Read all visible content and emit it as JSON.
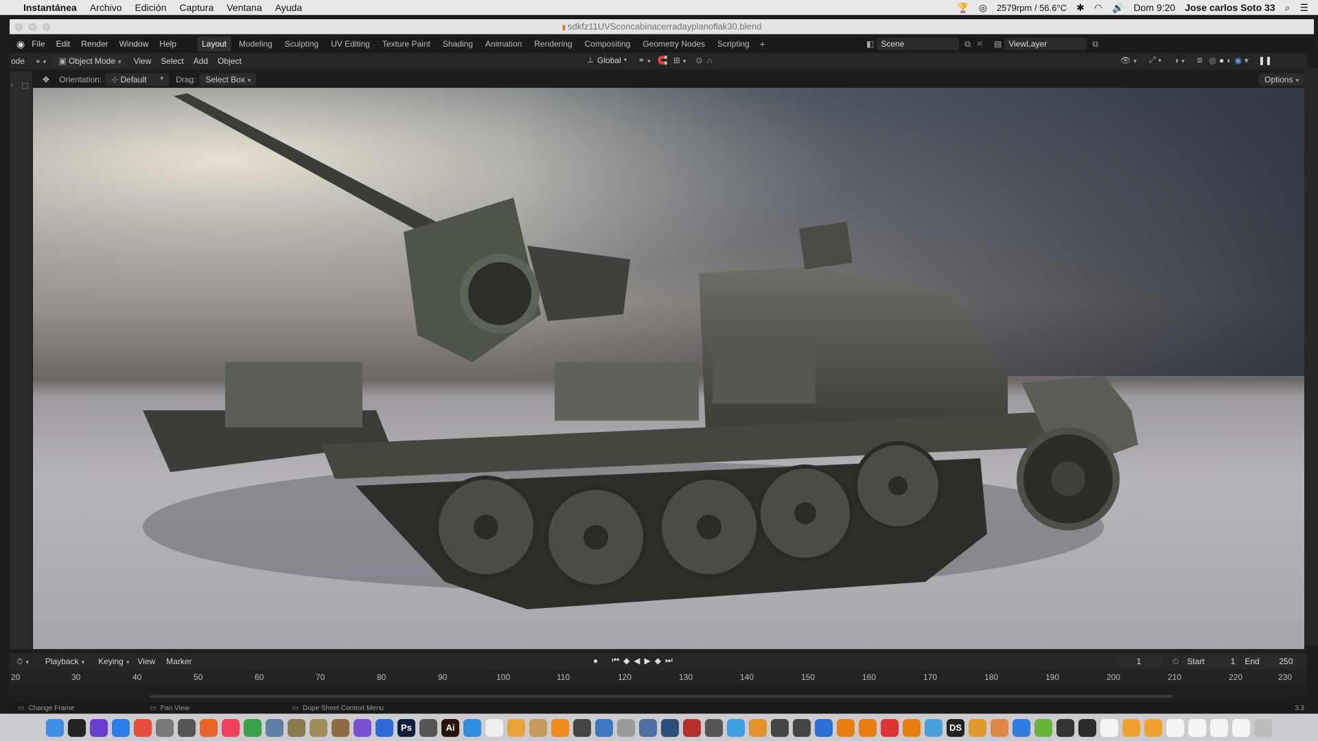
{
  "mac": {
    "app": "Instantánea",
    "menus": [
      "Archivo",
      "Edición",
      "Captura",
      "Ventana",
      "Ayuda"
    ],
    "status": {
      "temp": "2579rpm / 56.6°C",
      "clock": "Dom 9:20",
      "user": "Jose carlos Soto 33"
    }
  },
  "window": {
    "title": "sdkfz11UVSconcabinacerradayplanoflak30.blend"
  },
  "topbar": {
    "menus": [
      "File",
      "Edit",
      "Render",
      "Window",
      "Help"
    ],
    "workspaces": [
      "Layout",
      "Modeling",
      "Sculpting",
      "UV Editing",
      "Texture Paint",
      "Shading",
      "Animation",
      "Rendering",
      "Compositing",
      "Geometry Nodes",
      "Scripting"
    ],
    "active_workspace": "Layout",
    "scene": "Scene",
    "view_layer": "ViewLayer"
  },
  "viewport_header": {
    "editor_left": "ode",
    "mode": "Object Mode",
    "menus": [
      "View",
      "Select",
      "Add",
      "Object"
    ],
    "transform": "Global"
  },
  "tool_header": {
    "orientation_label": "Orientation:",
    "orientation_value": "Default",
    "drag_label": "Drag:",
    "drag_value": "Select Box",
    "options": "Options"
  },
  "timeline": {
    "menus": [
      "Playback",
      "Keying",
      "View",
      "Marker"
    ],
    "current_frame": "1",
    "start_label": "Start",
    "start": "1",
    "end_label": "End",
    "end": "250",
    "ruler": [
      "20",
      "30",
      "40",
      "50",
      "60",
      "70",
      "80",
      "90",
      "100",
      "110",
      "120",
      "130",
      "140",
      "150",
      "160",
      "170",
      "180",
      "190",
      "200",
      "210",
      "220",
      "230"
    ]
  },
  "statusbar": [
    "Change Frame",
    "Pan View",
    "Dope Sheet Context Menu"
  ],
  "version": "3.3",
  "dock": [
    {
      "name": "finder",
      "color": "#3a8ee6"
    },
    {
      "name": "terminal",
      "color": "#222"
    },
    {
      "name": "siri",
      "color": "#6a3fcf"
    },
    {
      "name": "safari",
      "color": "#2b7de9"
    },
    {
      "name": "chrome",
      "color": "#e74c3c"
    },
    {
      "name": "app-a",
      "color": "#777"
    },
    {
      "name": "launchpad",
      "color": "#555"
    },
    {
      "name": "firefox",
      "color": "#e8632b"
    },
    {
      "name": "music",
      "color": "#f0405a"
    },
    {
      "name": "utorrent",
      "color": "#3aa04a"
    },
    {
      "name": "app-b",
      "color": "#5d7fa8"
    },
    {
      "name": "app-c",
      "color": "#8a7a50"
    },
    {
      "name": "app-d",
      "color": "#9d8e5a"
    },
    {
      "name": "app-e",
      "color": "#8c6b42"
    },
    {
      "name": "affinity",
      "color": "#7a4fd6"
    },
    {
      "name": "app-f",
      "color": "#2f6bd8"
    },
    {
      "name": "photoshop",
      "color": "#0d1f3c",
      "label": "Ps"
    },
    {
      "name": "app-g",
      "color": "#555"
    },
    {
      "name": "illustrator",
      "color": "#2a1305",
      "label": "Ai"
    },
    {
      "name": "app-h",
      "color": "#2f8fe0"
    },
    {
      "name": "app-i",
      "color": "#eee"
    },
    {
      "name": "app-j",
      "color": "#e8a33b"
    },
    {
      "name": "app-k",
      "color": "#c49a58"
    },
    {
      "name": "vlc",
      "color": "#f08a1c"
    },
    {
      "name": "app-l",
      "color": "#444"
    },
    {
      "name": "app-m",
      "color": "#3b78c4"
    },
    {
      "name": "app-n",
      "color": "#999"
    },
    {
      "name": "app-o",
      "color": "#4d6fa0"
    },
    {
      "name": "app-p",
      "color": "#2c4d7a"
    },
    {
      "name": "app-q",
      "color": "#b3302c"
    },
    {
      "name": "app-r",
      "color": "#555"
    },
    {
      "name": "app-s",
      "color": "#3b9fe0"
    },
    {
      "name": "app-t",
      "color": "#e2902a"
    },
    {
      "name": "app-u",
      "color": "#444"
    },
    {
      "name": "app-v",
      "color": "#444"
    },
    {
      "name": "app-w",
      "color": "#2a6fd4"
    },
    {
      "name": "blender-a",
      "color": "#e87d0d"
    },
    {
      "name": "blender-b",
      "color": "#e87d0d"
    },
    {
      "name": "app-x",
      "color": "#d33"
    },
    {
      "name": "blender-c",
      "color": "#e87d0d"
    },
    {
      "name": "app-y",
      "color": "#4aa0d8"
    },
    {
      "name": "daz",
      "color": "#222",
      "label": "DS"
    },
    {
      "name": "app-z",
      "color": "#e09a2c"
    },
    {
      "name": "app-aa",
      "color": "#d84"
    },
    {
      "name": "bluetooth",
      "color": "#2d7de0"
    },
    {
      "name": "android",
      "color": "#67b23a"
    },
    {
      "name": "app-bb",
      "color": "#333"
    },
    {
      "name": "app-cc",
      "color": "#2b2b2b"
    },
    {
      "name": "doc-a",
      "color": "#f5f5f5"
    },
    {
      "name": "doc-b",
      "color": "#f0a030"
    },
    {
      "name": "doc-c",
      "color": "#f0a030"
    },
    {
      "name": "doc-d",
      "color": "#f5f5f5"
    },
    {
      "name": "doc-e",
      "color": "#f5f5f5"
    },
    {
      "name": "doc-f",
      "color": "#f5f5f5"
    },
    {
      "name": "doc-g",
      "color": "#f5f5f5"
    },
    {
      "name": "trash",
      "color": "#bbb"
    }
  ]
}
